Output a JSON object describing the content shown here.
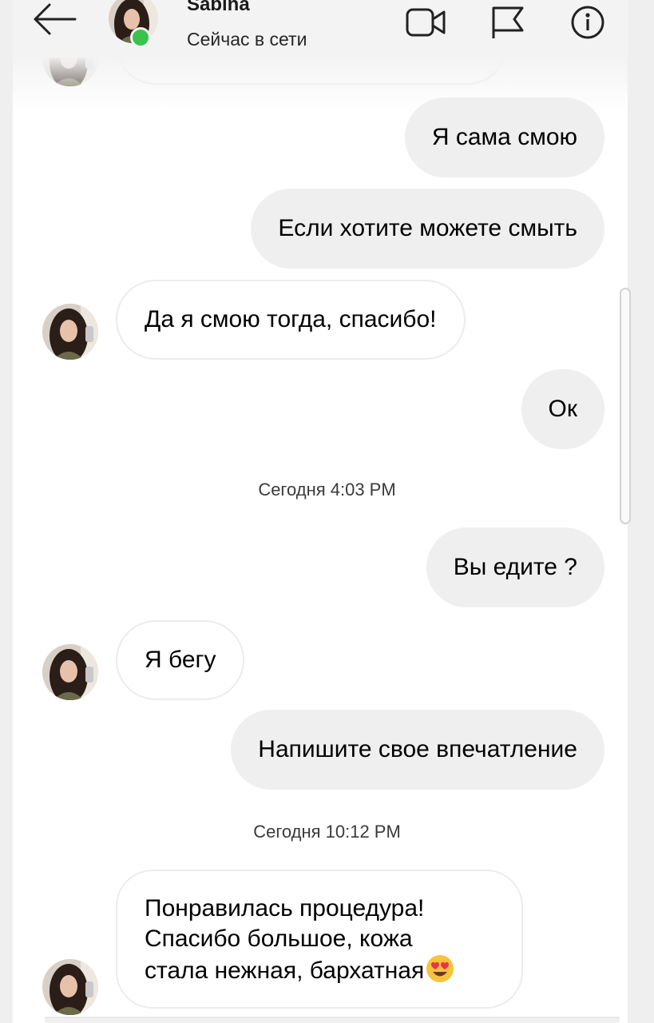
{
  "header": {
    "contact_name": "Sabina",
    "status": "Сейчас в сети",
    "icons": [
      "back-arrow-icon",
      "video-call-icon",
      "flag-icon",
      "info-icon"
    ],
    "online_color": "#3bc24b"
  },
  "messages": {
    "m1": "Я сама смою",
    "m2": "Если хотите можете смыть",
    "m3": "Да я смою тогда, спасибо!",
    "m4": "Ок",
    "m5": "Вы едите ?",
    "m6": "Я бегу",
    "m7": "Напишите свое впечатление",
    "m8_line1": "Понравилась процедура!",
    "m8_line2": "Спасибо большое, кожа",
    "m8_line3": "стала нежная, бархатная"
  },
  "timestamps": {
    "t1": "Сегодня 4:03 PM",
    "t2": "Сегодня 10:12 PM"
  },
  "colors": {
    "outgoing_bubble": "#efefef",
    "incoming_bubble": "#ffffff",
    "incoming_border": "#ececec"
  },
  "emoji": "heart-eyes-emoji"
}
